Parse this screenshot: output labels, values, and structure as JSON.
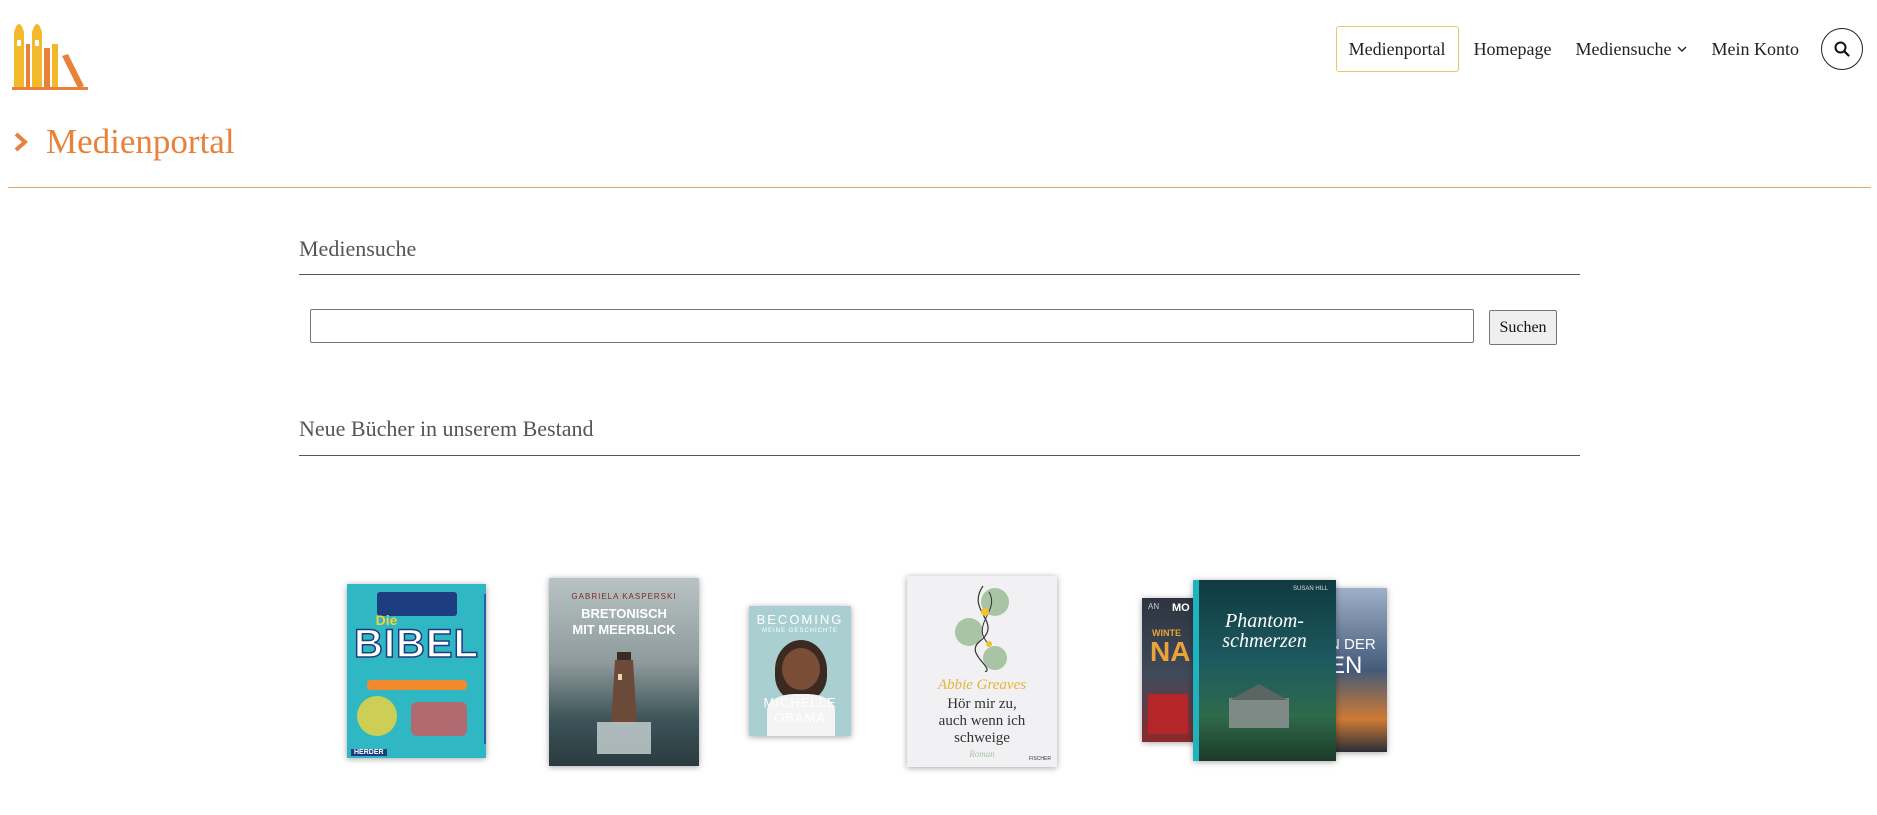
{
  "nav": {
    "items": [
      {
        "label": "Medienportal",
        "active": true
      },
      {
        "label": "Homepage",
        "active": false
      },
      {
        "label": "Mediensuche",
        "active": false,
        "has_dropdown": true
      },
      {
        "label": "Mein Konto",
        "active": false
      }
    ],
    "search_icon": "search-icon"
  },
  "page": {
    "title": "Medienportal",
    "title_icon": "chevron-right-icon",
    "accent_color": "#e8823a"
  },
  "search_section": {
    "heading": "Mediensuche",
    "input_value": "",
    "button_label": "Suchen"
  },
  "books_section": {
    "heading": "Neue Bücher in unserem Bestand",
    "books": [
      {
        "cover_lines": [
          "Die",
          "BIBEL"
        ],
        "publisher": "HERDER"
      },
      {
        "author": "GABRIELA KASPERSKI",
        "title_lines": [
          "BRETONISCH",
          "MIT MEERBLICK"
        ]
      },
      {
        "title": "BECOMING",
        "subtitle": "MEINE GESCHICHTE",
        "author_lines": [
          "MICHELLE",
          "OBAMA"
        ]
      },
      {
        "author": "Abbie Greaves",
        "title_lines": [
          "Hör mir zu,",
          "auch wenn ich",
          "schweige"
        ],
        "genre": "Roman",
        "publisher": "FISCHER"
      },
      {
        "left_fragments": [
          "AN",
          "MO",
          "WINTE",
          "NA"
        ],
        "title_lines": [
          "Phantom-",
          "schmerzen"
        ],
        "author": "SUSAN HILL",
        "right_fragments": [
          "N DER",
          "EN"
        ]
      }
    ]
  }
}
